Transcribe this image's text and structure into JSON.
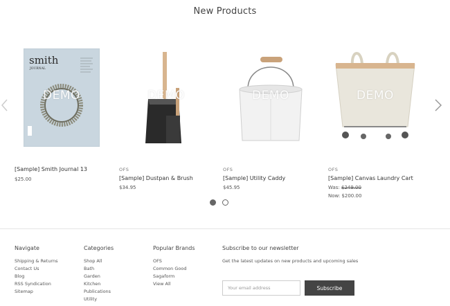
{
  "section": {
    "title": "New Products"
  },
  "demo_watermark": "DEMO",
  "products": [
    {
      "brand": "",
      "name": "[Sample] Smith Journal 13",
      "price": "$25.00"
    },
    {
      "brand": "OFS",
      "name": "[Sample] Dustpan & Brush",
      "price": "$34.95"
    },
    {
      "brand": "OFS",
      "name": "[Sample] Utility Caddy",
      "price": "$45.95"
    },
    {
      "brand": "OFS",
      "name": "[Sample] Canvas Laundry Cart",
      "was_label": "Was:",
      "was_price": "$249.00",
      "now_label": "Now: $200.00"
    }
  ],
  "journal_cover": {
    "title": "smith",
    "subtitle": "JOURNAL"
  },
  "footer": {
    "navigate": {
      "heading": "Navigate",
      "links": [
        "Shipping & Returns",
        "Contact Us",
        "Blog",
        "RSS Syndication",
        "Sitemap"
      ]
    },
    "categories": {
      "heading": "Categories",
      "links": [
        "Shop All",
        "Bath",
        "Garden",
        "Kitchen",
        "Publications",
        "Utility"
      ]
    },
    "brands": {
      "heading": "Popular Brands",
      "links": [
        "OFS",
        "Common Good",
        "Sagaform",
        "View All"
      ]
    },
    "newsletter": {
      "heading": "Subscribe to our newsletter",
      "description": "Get the latest updates on new products and upcoming sales",
      "placeholder": "Your email address",
      "button": "Subscribe"
    }
  },
  "colors": {
    "button_bg": "#444444",
    "divider": "#e5e5e5",
    "dot": "#666666"
  },
  "icons": {
    "prev": "chevron-left-icon",
    "next": "chevron-right-icon"
  }
}
